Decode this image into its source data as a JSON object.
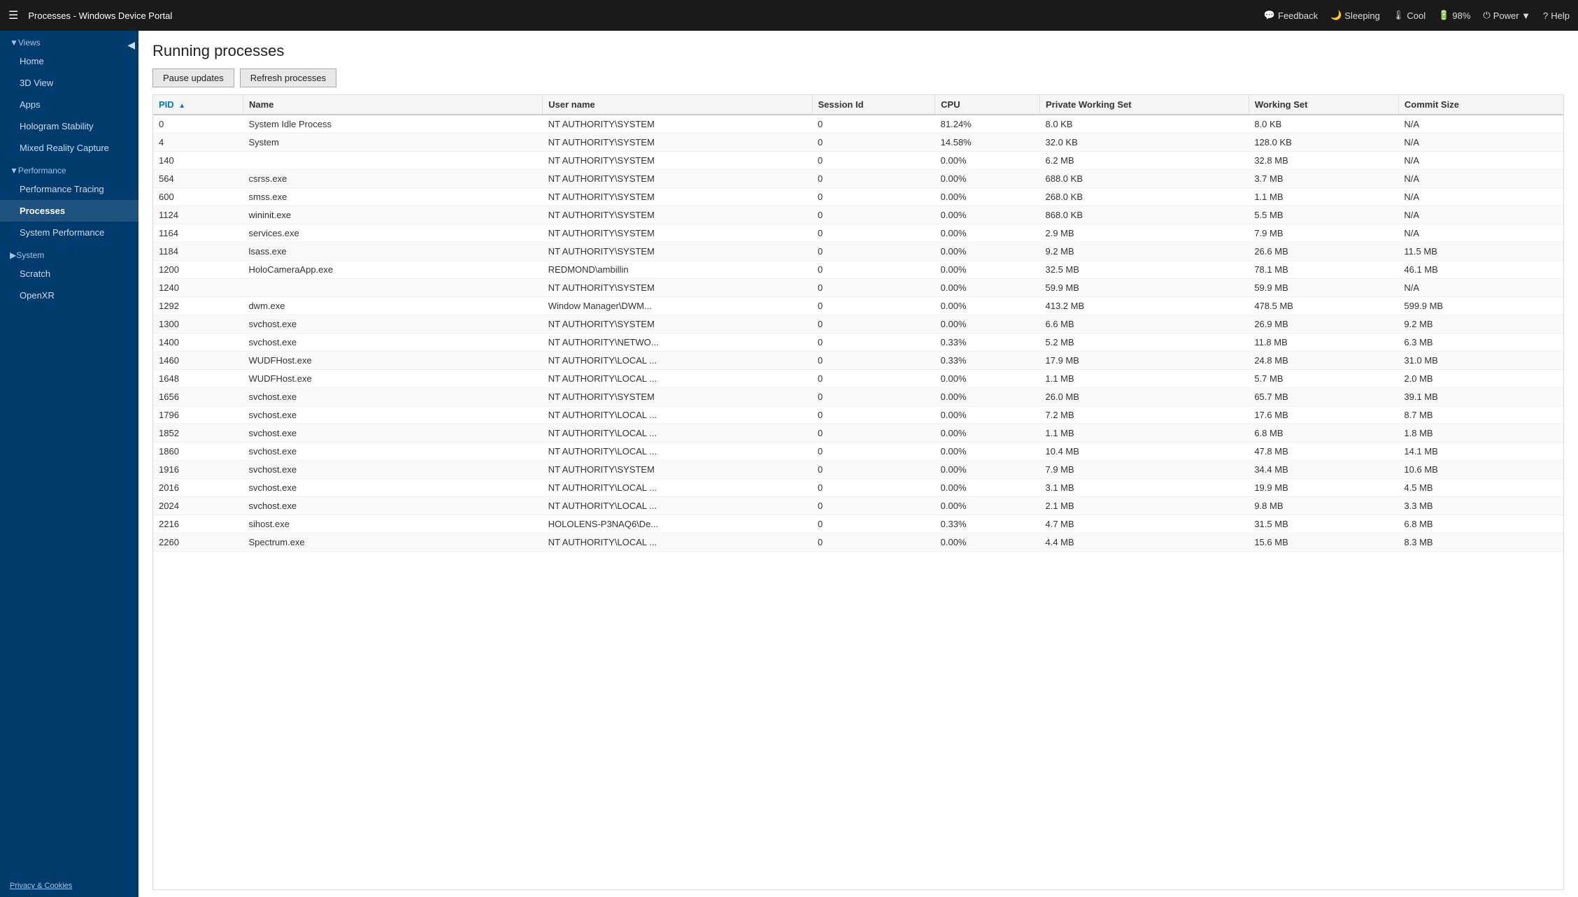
{
  "topbar": {
    "menu_icon": "☰",
    "title": "Processes - Windows Device Portal",
    "actions": [
      {
        "label": "Feedback",
        "icon": "💬",
        "name": "feedback"
      },
      {
        "label": "Sleeping",
        "icon": "🌙",
        "name": "sleeping"
      },
      {
        "label": "Cool",
        "icon": "🌡",
        "name": "cool"
      },
      {
        "label": "98%",
        "icon": "🔋",
        "name": "battery"
      },
      {
        "label": "Power ▼",
        "icon": "⏻",
        "name": "power"
      },
      {
        "label": "Help",
        "icon": "?",
        "name": "help"
      }
    ]
  },
  "sidebar": {
    "collapse_label": "◀",
    "views_label": "▼Views",
    "items_views": [
      {
        "label": "Home",
        "name": "home"
      },
      {
        "label": "3D View",
        "name": "3d-view"
      },
      {
        "label": "Apps",
        "name": "apps"
      },
      {
        "label": "Hologram Stability",
        "name": "hologram-stability"
      },
      {
        "label": "Mixed Reality Capture",
        "name": "mixed-reality-capture"
      }
    ],
    "performance_label": "▼Performance",
    "items_performance": [
      {
        "label": "Performance Tracing",
        "name": "performance-tracing"
      },
      {
        "label": "Processes",
        "name": "processes",
        "active": true
      },
      {
        "label": "System Performance",
        "name": "system-performance"
      }
    ],
    "system_label": "▶System",
    "items_system": [],
    "scratch_label": "Scratch",
    "openxr_label": "OpenXR",
    "footer": "Privacy & Cookies"
  },
  "content": {
    "title": "Running processes",
    "buttons": [
      {
        "label": "Pause updates",
        "name": "pause-updates"
      },
      {
        "label": "Refresh processes",
        "name": "refresh-processes"
      }
    ]
  },
  "table": {
    "columns": [
      {
        "label": "PID",
        "name": "pid",
        "sorted": true
      },
      {
        "label": "Name",
        "name": "name"
      },
      {
        "label": "User name",
        "name": "username"
      },
      {
        "label": "Session Id",
        "name": "session-id"
      },
      {
        "label": "CPU",
        "name": "cpu"
      },
      {
        "label": "Private Working Set",
        "name": "private-working-set"
      },
      {
        "label": "Working Set",
        "name": "working-set"
      },
      {
        "label": "Commit Size",
        "name": "commit-size"
      }
    ],
    "rows": [
      {
        "pid": "0",
        "name": "System Idle Process",
        "user": "NT AUTHORITY\\SYSTEM",
        "session": "0",
        "cpu": "81.24%",
        "pws": "8.0 KB",
        "ws": "8.0 KB",
        "commit": "N/A"
      },
      {
        "pid": "4",
        "name": "System",
        "user": "NT AUTHORITY\\SYSTEM",
        "session": "0",
        "cpu": "14.58%",
        "pws": "32.0 KB",
        "ws": "128.0 KB",
        "commit": "N/A"
      },
      {
        "pid": "140",
        "name": "",
        "user": "NT AUTHORITY\\SYSTEM",
        "session": "0",
        "cpu": "0.00%",
        "pws": "6.2 MB",
        "ws": "32.8 MB",
        "commit": "N/A"
      },
      {
        "pid": "564",
        "name": "csrss.exe",
        "user": "NT AUTHORITY\\SYSTEM",
        "session": "0",
        "cpu": "0.00%",
        "pws": "688.0 KB",
        "ws": "3.7 MB",
        "commit": "N/A"
      },
      {
        "pid": "600",
        "name": "smss.exe",
        "user": "NT AUTHORITY\\SYSTEM",
        "session": "0",
        "cpu": "0.00%",
        "pws": "268.0 KB",
        "ws": "1.1 MB",
        "commit": "N/A"
      },
      {
        "pid": "1124",
        "name": "wininit.exe",
        "user": "NT AUTHORITY\\SYSTEM",
        "session": "0",
        "cpu": "0.00%",
        "pws": "868.0 KB",
        "ws": "5.5 MB",
        "commit": "N/A"
      },
      {
        "pid": "1164",
        "name": "services.exe",
        "user": "NT AUTHORITY\\SYSTEM",
        "session": "0",
        "cpu": "0.00%",
        "pws": "2.9 MB",
        "ws": "7.9 MB",
        "commit": "N/A"
      },
      {
        "pid": "1184",
        "name": "lsass.exe",
        "user": "NT AUTHORITY\\SYSTEM",
        "session": "0",
        "cpu": "0.00%",
        "pws": "9.2 MB",
        "ws": "26.6 MB",
        "commit": "11.5 MB"
      },
      {
        "pid": "1200",
        "name": "HoloCameraApp.exe",
        "user": "REDMOND\\ambillin",
        "session": "0",
        "cpu": "0.00%",
        "pws": "32.5 MB",
        "ws": "78.1 MB",
        "commit": "46.1 MB"
      },
      {
        "pid": "1240",
        "name": "",
        "user": "NT AUTHORITY\\SYSTEM",
        "session": "0",
        "cpu": "0.00%",
        "pws": "59.9 MB",
        "ws": "59.9 MB",
        "commit": "N/A"
      },
      {
        "pid": "1292",
        "name": "dwm.exe",
        "user": "Window Manager\\DWM...",
        "session": "0",
        "cpu": "0.00%",
        "pws": "413.2 MB",
        "ws": "478.5 MB",
        "commit": "599.9 MB"
      },
      {
        "pid": "1300",
        "name": "svchost.exe",
        "user": "NT AUTHORITY\\SYSTEM",
        "session": "0",
        "cpu": "0.00%",
        "pws": "6.6 MB",
        "ws": "26.9 MB",
        "commit": "9.2 MB"
      },
      {
        "pid": "1400",
        "name": "svchost.exe",
        "user": "NT AUTHORITY\\NETWO...",
        "session": "0",
        "cpu": "0.33%",
        "pws": "5.2 MB",
        "ws": "11.8 MB",
        "commit": "6.3 MB"
      },
      {
        "pid": "1460",
        "name": "WUDFHost.exe",
        "user": "NT AUTHORITY\\LOCAL ...",
        "session": "0",
        "cpu": "0.33%",
        "pws": "17.9 MB",
        "ws": "24.8 MB",
        "commit": "31.0 MB"
      },
      {
        "pid": "1648",
        "name": "WUDFHost.exe",
        "user": "NT AUTHORITY\\LOCAL ...",
        "session": "0",
        "cpu": "0.00%",
        "pws": "1.1 MB",
        "ws": "5.7 MB",
        "commit": "2.0 MB"
      },
      {
        "pid": "1656",
        "name": "svchost.exe",
        "user": "NT AUTHORITY\\SYSTEM",
        "session": "0",
        "cpu": "0.00%",
        "pws": "26.0 MB",
        "ws": "65.7 MB",
        "commit": "39.1 MB"
      },
      {
        "pid": "1796",
        "name": "svchost.exe",
        "user": "NT AUTHORITY\\LOCAL ...",
        "session": "0",
        "cpu": "0.00%",
        "pws": "7.2 MB",
        "ws": "17.6 MB",
        "commit": "8.7 MB"
      },
      {
        "pid": "1852",
        "name": "svchost.exe",
        "user": "NT AUTHORITY\\LOCAL ...",
        "session": "0",
        "cpu": "0.00%",
        "pws": "1.1 MB",
        "ws": "6.8 MB",
        "commit": "1.8 MB"
      },
      {
        "pid": "1860",
        "name": "svchost.exe",
        "user": "NT AUTHORITY\\LOCAL ...",
        "session": "0",
        "cpu": "0.00%",
        "pws": "10.4 MB",
        "ws": "47.8 MB",
        "commit": "14.1 MB"
      },
      {
        "pid": "1916",
        "name": "svchost.exe",
        "user": "NT AUTHORITY\\SYSTEM",
        "session": "0",
        "cpu": "0.00%",
        "pws": "7.9 MB",
        "ws": "34.4 MB",
        "commit": "10.6 MB"
      },
      {
        "pid": "2016",
        "name": "svchost.exe",
        "user": "NT AUTHORITY\\LOCAL ...",
        "session": "0",
        "cpu": "0.00%",
        "pws": "3.1 MB",
        "ws": "19.9 MB",
        "commit": "4.5 MB"
      },
      {
        "pid": "2024",
        "name": "svchost.exe",
        "user": "NT AUTHORITY\\LOCAL ...",
        "session": "0",
        "cpu": "0.00%",
        "pws": "2.1 MB",
        "ws": "9.8 MB",
        "commit": "3.3 MB"
      },
      {
        "pid": "2216",
        "name": "sihost.exe",
        "user": "HOLOLENS-P3NAQ6\\De...",
        "session": "0",
        "cpu": "0.33%",
        "pws": "4.7 MB",
        "ws": "31.5 MB",
        "commit": "6.8 MB"
      },
      {
        "pid": "2260",
        "name": "Spectrum.exe",
        "user": "NT AUTHORITY\\LOCAL ...",
        "session": "0",
        "cpu": "0.00%",
        "pws": "4.4 MB",
        "ws": "15.6 MB",
        "commit": "8.3 MB"
      }
    ]
  }
}
